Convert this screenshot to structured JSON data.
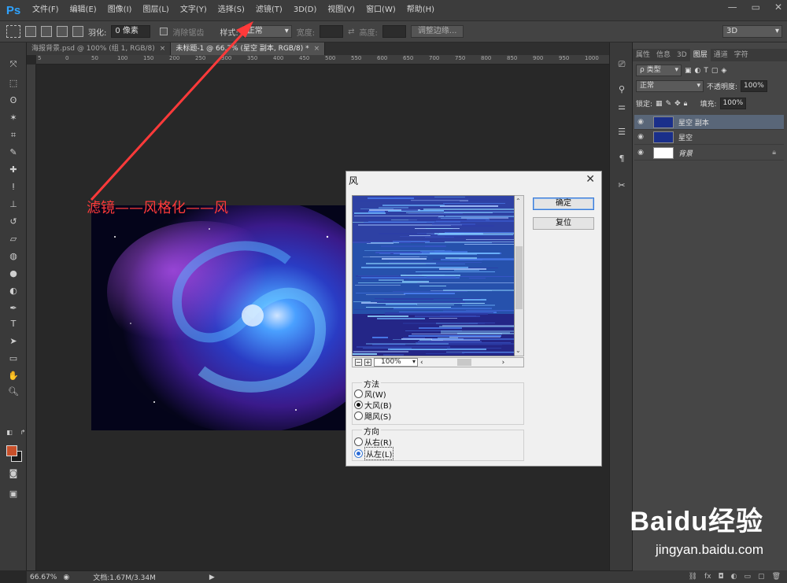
{
  "app": {
    "logo": "Ps",
    "menu": [
      "文件(F)",
      "编辑(E)",
      "图像(I)",
      "图层(L)",
      "文字(Y)",
      "选择(S)",
      "滤镜(T)",
      "3D(D)",
      "视图(V)",
      "窗口(W)",
      "帮助(H)"
    ],
    "window_controls": [
      "—",
      "▭",
      "✕"
    ]
  },
  "options": {
    "feather_label": "羽化:",
    "feather_value": "0 像素",
    "antialias_label": "消除锯齿",
    "style_label": "样式:",
    "style_value": "正常",
    "width_label": "宽度:",
    "height_label": "高度:",
    "refine_edge": "调整边缘...",
    "workspace": "3D"
  },
  "tabs": [
    {
      "label": "海报背景.psd @ 100% (组 1, RGB/8)",
      "close": "×"
    },
    {
      "label": "未标题-1 @ 66.7% (星空 副本, RGB/8) *",
      "close": "×"
    }
  ],
  "ruler_top": [
    "5",
    "0",
    "50",
    "100",
    "150",
    "200",
    "250",
    "300",
    "350",
    "400",
    "450",
    "500",
    "550",
    "600",
    "650",
    "700",
    "750",
    "800",
    "850",
    "900",
    "950",
    "1000",
    "1050"
  ],
  "annotation": "滤镜——风格化——风",
  "dialog": {
    "title": "风",
    "close": "✕",
    "ok": "确定",
    "reset": "复位",
    "zoom": "100%",
    "zoom_minus": "−",
    "zoom_plus": "+",
    "method_title": "方法",
    "method_options": [
      "风(W)",
      "大风(B)",
      "飓风(S)"
    ],
    "method_selected": 1,
    "direction_title": "方向",
    "direction_options": [
      "从右(R)",
      "从左(L)"
    ],
    "direction_selected": 1
  },
  "layers_panel": {
    "tabs": [
      "属性",
      "信息",
      "3D",
      "图层",
      "通道",
      "字符"
    ],
    "active_tab": "图层",
    "kind_label": "ρ 类型",
    "blend_mode": "正常",
    "opacity_label": "不透明度:",
    "opacity_value": "100%",
    "lock_label": "锁定:",
    "fill_label": "填充:",
    "fill_value": "100%",
    "layers": [
      {
        "name": "星空 副本",
        "selected": true
      },
      {
        "name": "星空",
        "selected": false
      },
      {
        "name": "背景",
        "selected": false,
        "locked": true
      }
    ]
  },
  "status": {
    "zoom": "66.67%",
    "doc": "文档:1.67M/3.34M"
  },
  "watermark": {
    "brand": "Baidu经验",
    "url": "jingyan.baidu.com"
  }
}
